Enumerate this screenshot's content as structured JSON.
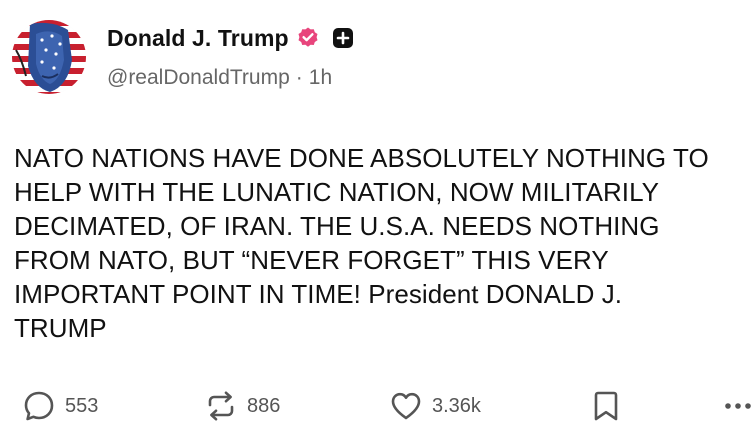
{
  "author": {
    "display_name": "Donald J. Trump",
    "handle": "@realDonaldTrump",
    "separator": "·",
    "timestamp": "1h",
    "verified_badge_icon": "verified-badge-icon",
    "follow_icon": "plus-icon",
    "verified_color": "#e8457c"
  },
  "post": {
    "text": "NATO NATIONS HAVE DONE ABSOLUTELY NOTHING TO\nHELP WITH THE LUNATIC NATION, NOW MILITARILY\nDECIMATED, OF IRAN. THE U.S.A. NEEDS NOTHING\nFROM NATO, BUT “NEVER FORGET” THIS VERY\nIMPORTANT POINT IN TIME! President DONALD J.\nTRUMP"
  },
  "actions": {
    "replies": {
      "icon": "comment-icon",
      "count": "553"
    },
    "reposts": {
      "icon": "repost-icon",
      "count": "886"
    },
    "likes": {
      "icon": "heart-icon",
      "count": "3.36k"
    },
    "bookmark": {
      "icon": "bookmark-icon"
    },
    "more": {
      "icon": "more-icon"
    }
  }
}
